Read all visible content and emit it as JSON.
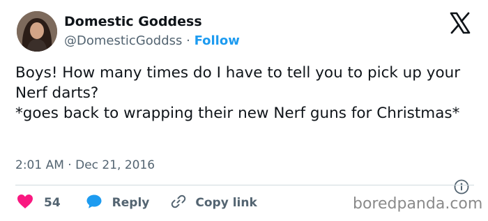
{
  "author": {
    "name": "Domestic Goddess",
    "handle": "@DomesticGoddss",
    "separator": " · ",
    "follow_label": "Follow"
  },
  "tweet": {
    "line1": "Boys! How many times do I have to tell you to pick up your Nerf darts?",
    "line2": "*goes back to wrapping their new Nerf guns for Christmas*"
  },
  "meta": {
    "time": "2:01 AM",
    "separator": " · ",
    "date": "Dec 21, 2016"
  },
  "actions": {
    "like_count": "54",
    "reply_label": "Reply",
    "copy_label": "Copy link"
  },
  "watermark": "boredpanda.com",
  "icons": {
    "logo": "x-logo-icon",
    "info": "info-icon",
    "like": "heart-icon",
    "reply": "speech-bubble-icon",
    "copy": "link-icon"
  },
  "colors": {
    "accent": "#1d9bf0",
    "like": "#f91880",
    "text": "#0f1419",
    "muted": "#536471"
  }
}
